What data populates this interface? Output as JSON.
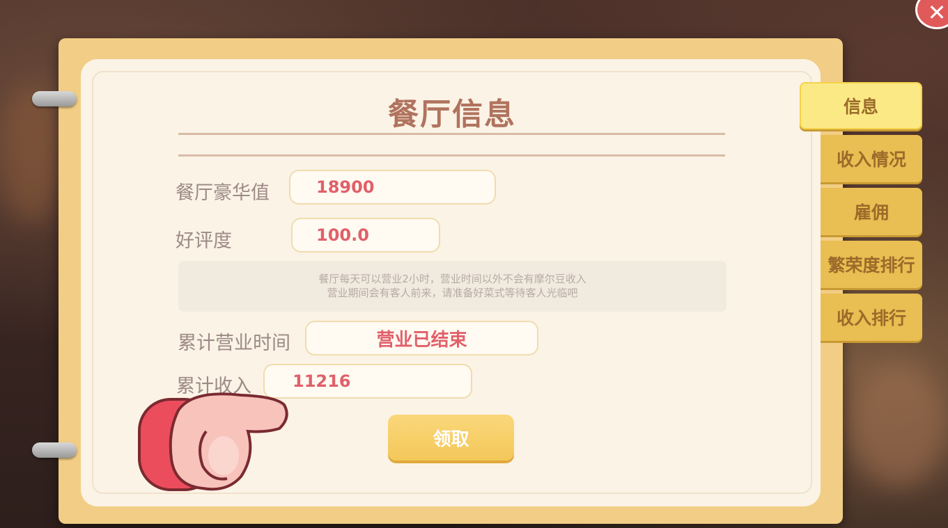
{
  "window": {
    "title": "餐厅信息"
  },
  "fields": [
    {
      "label": "餐厅豪华值",
      "value": "18900"
    },
    {
      "label": "好评度",
      "value": "100.0"
    },
    {
      "label": "累计营业时间",
      "value": "营业已结束"
    },
    {
      "label": "累计收入",
      "value": "11216"
    }
  ],
  "notice": {
    "line1": "餐厅每天可以营业2小时，营业时间以外不会有摩尔豆收入",
    "line2": "营业期间会有客人前来，请准备好菜式等待客人光临吧"
  },
  "claim_button": {
    "label": "领取"
  },
  "tabs": [
    {
      "label": "信息",
      "active": true
    },
    {
      "label": "收入情况",
      "active": false
    },
    {
      "label": "雇佣",
      "active": false
    },
    {
      "label": "繁荣度排行",
      "active": false
    },
    {
      "label": "收入排行",
      "active": false
    }
  ],
  "icons": {
    "close": "close-icon",
    "pointer": "pointing-hand-icon"
  },
  "colors": {
    "value_text": "#e0606a",
    "tab_active": "#fbe985",
    "tab": "#e9be52",
    "button": "#f3c85a"
  }
}
